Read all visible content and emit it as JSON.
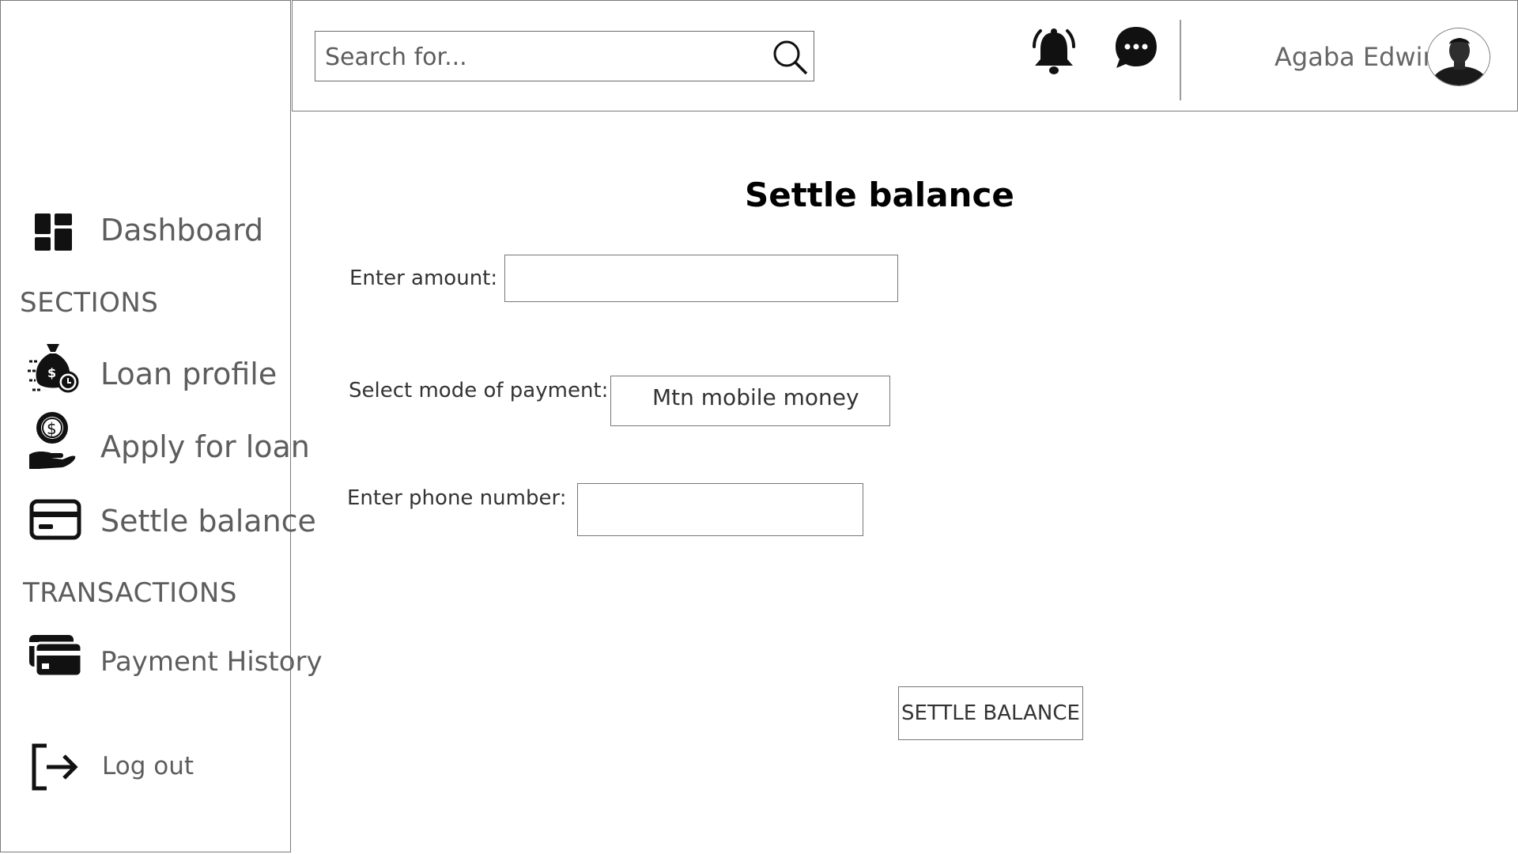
{
  "sidebar": {
    "dashboard_label": "Dashboard",
    "sections_title": "SECTIONS",
    "loan_profile_label": "Loan profile",
    "apply_loan_label": "Apply for loan",
    "settle_balance_label": "Settle balance",
    "transactions_title": "TRANSACTIONS",
    "payment_history_label": "Payment History",
    "logout_label": "Log out",
    "icons": {
      "dashboard": "dashboard-grid-icon",
      "loan_profile": "money-bag-clock-icon",
      "apply_loan": "hand-coin-icon",
      "settle_balance": "credit-card-icon",
      "payment_history": "cards-stack-icon",
      "logout": "logout-arrow-icon"
    }
  },
  "header": {
    "search_placeholder": "Search for...",
    "search_icon": "magnifier-icon",
    "notification_icon": "bell-ringing-icon",
    "messages_icon": "chat-bubble-dots-icon",
    "user_name": "Agaba Edwin"
  },
  "main": {
    "title": "Settle balance",
    "amount_label": "Enter amount:",
    "amount_value": "",
    "payment_mode_label": "Select mode of payment:",
    "payment_mode_value": "Mtn mobile money",
    "phone_label": "Enter phone number:",
    "phone_value": "",
    "submit_label": "SETTLE BALANCE"
  }
}
